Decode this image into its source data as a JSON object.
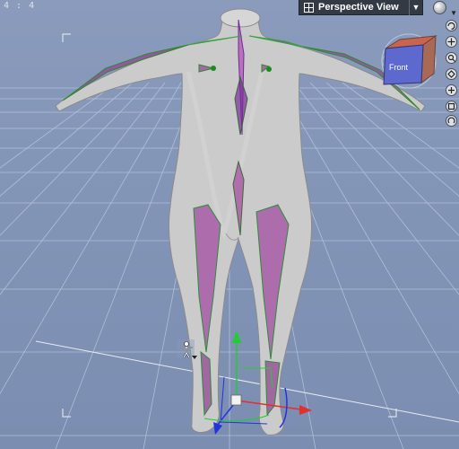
{
  "viewport": {
    "aspect_ratio": "4 : 4",
    "view_menu": {
      "label": "Perspective View",
      "icon": "grid-view-icon",
      "arrow_icon": "dropdown-arrow-icon"
    },
    "view_cube": {
      "face_label": "Front"
    },
    "tools": [
      "sphere-render-icon",
      "orbit-icon",
      "pan-icon",
      "zoom-icon",
      "frame-icon",
      "rotate-icon"
    ],
    "colors": {
      "background": "#8496b8",
      "grid": "#b9c4d8",
      "figure": "#c9c9c9",
      "x_axis": "#e03030",
      "y_axis": "#22cc33",
      "z_axis": "#2233dd"
    }
  }
}
